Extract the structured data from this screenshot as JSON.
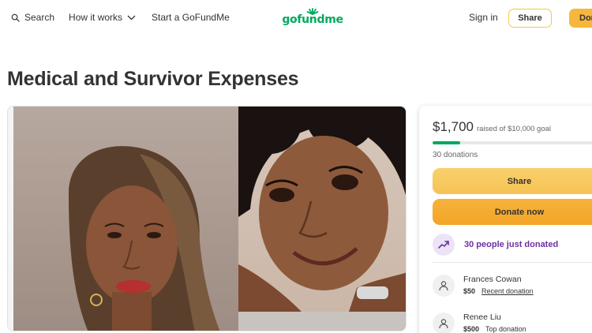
{
  "header": {
    "search_label": "Search",
    "how_it_works_label": "How it works",
    "start_label": "Start a GoFundMe",
    "logo_text": "gofundme",
    "sign_in_label": "Sign in",
    "share_label": "Share",
    "donate_label": "Donate"
  },
  "campaign": {
    "title": "Medical and Survivor Expenses"
  },
  "sidebar": {
    "amount_raised": "$1,700",
    "goal_text": "raised of $10,000 goal",
    "progress_fraction": 0.17,
    "donations_count": "30 donations",
    "share_button": "Share",
    "donate_button": "Donate now",
    "just_donated": "30 people just donated",
    "donors": [
      {
        "name": "Frances Cowan",
        "amount": "$50",
        "tag": "Recent donation"
      },
      {
        "name": "Renee Liu",
        "amount": "$500",
        "tag": "Top donation"
      }
    ]
  },
  "colors": {
    "brand_green": "#02a95c",
    "accent_yellow": "#f6c354",
    "accent_orange": "#f3a526",
    "purple": "#6b2fa3"
  },
  "icons": {
    "search": "search-icon",
    "chevron": "chevron-down-icon",
    "trend": "trending-up-icon",
    "donor": "donor-icon"
  }
}
